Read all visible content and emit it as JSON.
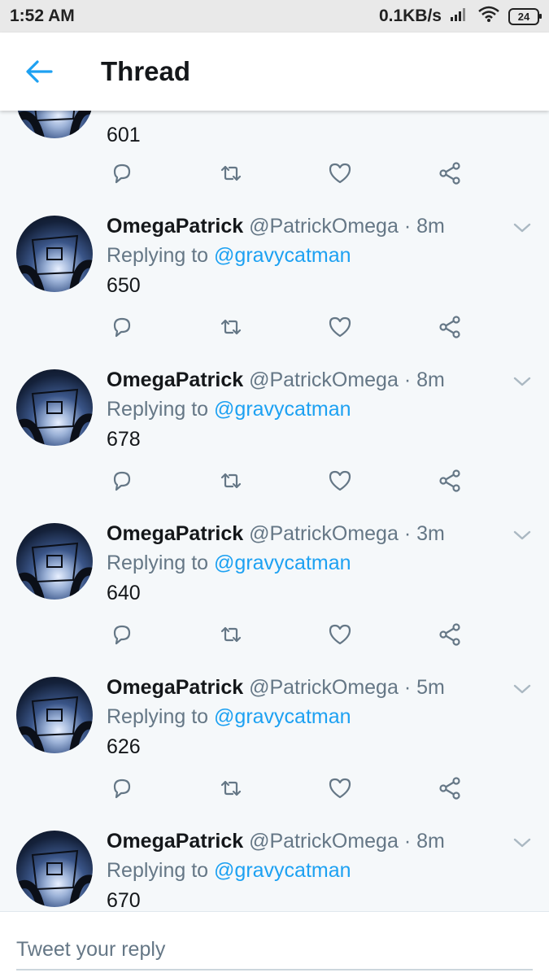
{
  "status_bar": {
    "time": "1:52 AM",
    "network_speed": "0.1KB/s",
    "battery_level": "24"
  },
  "header": {
    "title": "Thread",
    "back_icon": "arrow-left-icon"
  },
  "colors": {
    "accent": "#1da1f2",
    "text_primary": "#14171a",
    "text_secondary": "#657786",
    "divider": "#e1e8ed",
    "background": "#f5f8fa"
  },
  "tweets": [
    {
      "name": "",
      "handle": "",
      "time": "",
      "replying_to": "",
      "text": "601"
    },
    {
      "name": "OmegaPatrick",
      "handle": "@PatrickOmega",
      "time": "8m",
      "replying_prefix": "Replying to",
      "replying_to": "@gravycatman",
      "text": "650"
    },
    {
      "name": "OmegaPatrick",
      "handle": "@PatrickOmega",
      "time": "8m",
      "replying_prefix": "Replying to",
      "replying_to": "@gravycatman",
      "text": "678"
    },
    {
      "name": "OmegaPatrick",
      "handle": "@PatrickOmega",
      "time": "3m",
      "replying_prefix": "Replying to",
      "replying_to": "@gravycatman",
      "text": "640"
    },
    {
      "name": "OmegaPatrick",
      "handle": "@PatrickOmega",
      "time": "5m",
      "replying_prefix": "Replying to",
      "replying_to": "@gravycatman",
      "text": "626"
    },
    {
      "name": "OmegaPatrick",
      "handle": "@PatrickOmega",
      "time": "8m",
      "replying_prefix": "Replying to",
      "replying_to": "@gravycatman",
      "text": "670"
    }
  ],
  "reply_box": {
    "placeholder": "Tweet your reply"
  }
}
